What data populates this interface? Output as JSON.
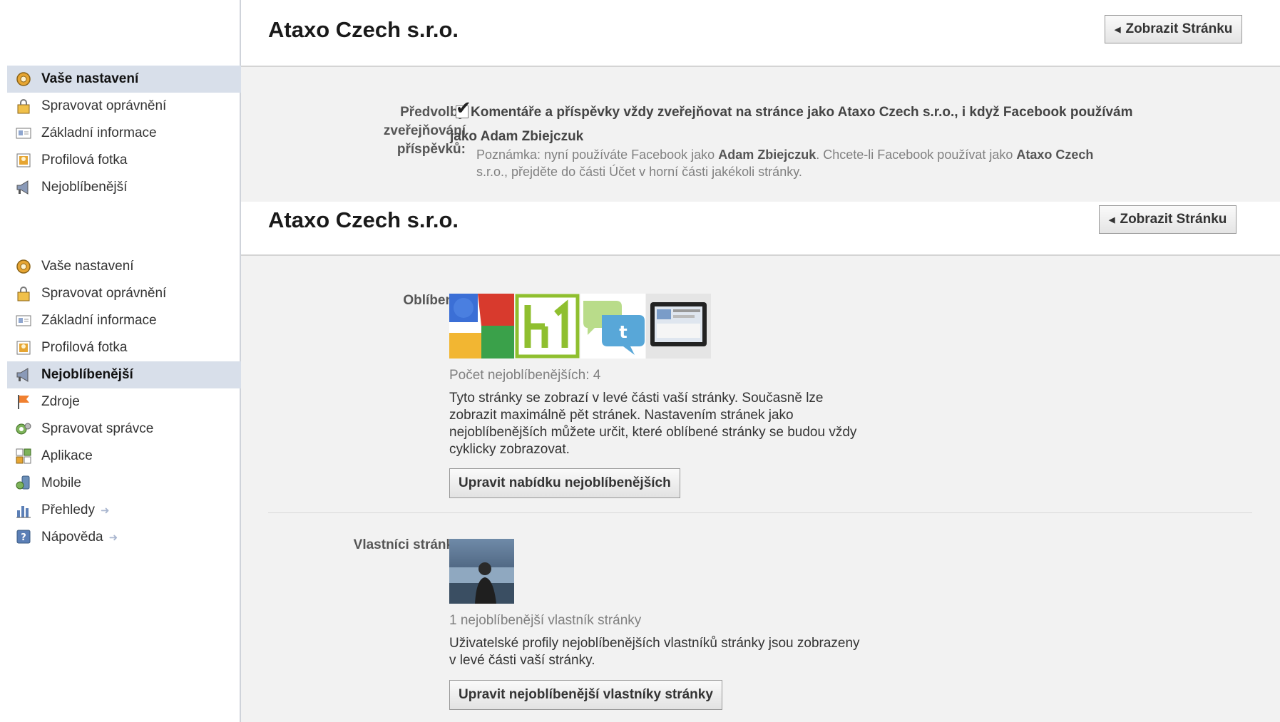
{
  "page": {
    "title": "Ataxo Czech s.r.o.",
    "view_page_label": "Zobrazit Stránku"
  },
  "sidebar_top": {
    "items": [
      {
        "label": "Vaše nastavení",
        "icon": "settings-gear-icon",
        "active": true
      },
      {
        "label": "Spravovat oprávnění",
        "icon": "lock-icon",
        "active": false
      },
      {
        "label": "Základní informace",
        "icon": "id-card-icon",
        "active": false
      },
      {
        "label": "Profilová fotka",
        "icon": "profile-photo-icon",
        "active": false
      },
      {
        "label": "Nejoblíbenější",
        "icon": "megaphone-icon",
        "active": false
      }
    ]
  },
  "sidebar_bottom": {
    "items": [
      {
        "label": "Vaše nastavení",
        "icon": "settings-gear-icon",
        "active": false
      },
      {
        "label": "Spravovat oprávnění",
        "icon": "lock-icon",
        "active": false
      },
      {
        "label": "Základní informace",
        "icon": "id-card-icon",
        "active": false
      },
      {
        "label": "Profilová fotka",
        "icon": "profile-photo-icon",
        "active": false
      },
      {
        "label": "Nejoblíbenější",
        "icon": "megaphone-icon",
        "active": true
      },
      {
        "label": "Zdroje",
        "icon": "flag-icon",
        "active": false
      },
      {
        "label": "Spravovat správce",
        "icon": "admin-gear-icon",
        "active": false
      },
      {
        "label": "Aplikace",
        "icon": "apps-icon",
        "active": false
      },
      {
        "label": "Mobile",
        "icon": "mobile-icon",
        "active": false
      },
      {
        "label": "Přehledy",
        "icon": "insights-chart-icon",
        "active": false,
        "external": true
      },
      {
        "label": "Nápověda",
        "icon": "help-icon",
        "active": false,
        "external": true
      }
    ]
  },
  "posting": {
    "label_line1": "Předvolby",
    "label_line2": "zveřejňování",
    "label_line3": "příspěvků:",
    "checkbox_checked": true,
    "checkbox_text_line1": "Komentáře a příspěvky vždy zveřejňovat na stránce jako Ataxo Czech s.r.o., i když Facebook používám",
    "checkbox_text_line2": "jako Adam Zbiejczuk",
    "note_prefix": "Poznámka: nyní používáte Facebook jako ",
    "note_user": "Adam Zbiejczuk",
    "note_middle": ". Chcete-li Facebook používat jako ",
    "note_page": "Ataxo Czech",
    "note_line2": "s.r.o., přejděte do části Účet v horní části jakékoli stránky."
  },
  "favorites": {
    "label": "Oblíbené:",
    "thumbnails": [
      "google-logo-icon",
      "h1-logo-icon",
      "twitter-chat-icon",
      "tablet-screen-icon"
    ],
    "count_text": "Počet nejoblíbenějších: 4",
    "description_lines": [
      "Tyto stránky se zobrazí v levé části vaší stránky. Současně lze",
      "zobrazit maximálně pět stránek. Nastavením stránek jako",
      "nejoblíbenějších můžete určit, které oblíbené stránky se budou vždy",
      "cyklicky zobrazovat."
    ],
    "edit_button": "Upravit nabídku nejoblíbenějších"
  },
  "owners": {
    "label": "Vlastníci stránky:",
    "count_text": "1 nejoblíbenější vlastník stránky",
    "description_lines": [
      "Uživatelské profily nejoblíbenějších vlastníků stránky jsou zobrazeny",
      "v levé části vaší stránky."
    ],
    "edit_button": "Upravit nejoblíbenější vlastníky stránky"
  }
}
